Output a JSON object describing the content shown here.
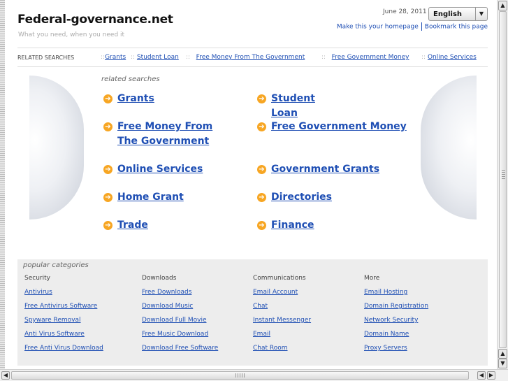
{
  "site": {
    "title": "Federal-governance.net",
    "tagline": "What you need, when you need it",
    "date": "June 28, 2011",
    "language": "English",
    "homepage_link": "Make this your homepage",
    "bookmark_link": "Bookmark this page"
  },
  "related_bar": {
    "label": "RELATED SEARCHES",
    "items": [
      "Grants",
      "Student Loan",
      "Free Money From The Government",
      "Free Government Money",
      "Online Services"
    ]
  },
  "related_searches": {
    "heading": "related searches",
    "items": [
      "Grants",
      "Student Loan",
      "Free Money From The Government",
      "Free Government Money",
      "Online Services",
      "Government Grants",
      "Home Grant",
      "Directories",
      "Trade",
      "Finance"
    ]
  },
  "popular": {
    "heading": "popular categories",
    "columns": [
      {
        "title": "Security",
        "links": [
          "Antivirus",
          "Free Antivirus Software",
          "Spyware Removal",
          "Anti Virus Software",
          "Free Anti Virus Download"
        ]
      },
      {
        "title": "Downloads",
        "links": [
          "Free Downloads",
          "Download Music",
          "Download Full Movie",
          "Free Music Download",
          "Download Free Software"
        ]
      },
      {
        "title": "Communications",
        "links": [
          "Email Account",
          "Chat",
          "Instant Messenger",
          "Email",
          "Chat Room"
        ]
      },
      {
        "title": "More",
        "links": [
          "Email Hosting",
          "Domain Registration",
          "Network Security",
          "Domain Name",
          "Proxy Servers"
        ]
      }
    ]
  },
  "icons": {
    "item_arrow": "arrow-right-circle-icon",
    "scroll_up": "scroll-up-icon",
    "scroll_down": "scroll-down-icon",
    "scroll_left": "scroll-left-icon",
    "scroll_right": "scroll-right-icon"
  },
  "colors": {
    "link": "#1f4fb4",
    "arrow_icon": "#f7a623",
    "panel": "#ededed"
  }
}
